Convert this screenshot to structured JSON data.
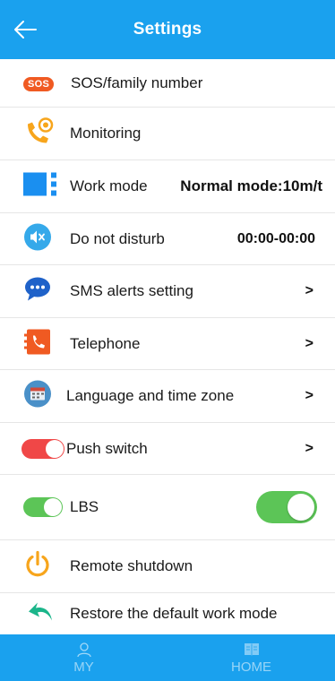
{
  "header": {
    "title": "Settings"
  },
  "rows": [
    {
      "label": "SOS/family number",
      "badge": "SOS"
    },
    {
      "label": "Monitoring"
    },
    {
      "label": "Work mode",
      "value": "Normal mode:10m/t"
    },
    {
      "label": "Do not disturb",
      "value": "00:00-00:00"
    },
    {
      "label": "SMS alerts setting",
      "arrow": ">"
    },
    {
      "label": "Telephone",
      "arrow": ">"
    },
    {
      "label": "Language and time zone",
      "arrow": ">"
    },
    {
      "label": "Push switch",
      "arrow": ">"
    },
    {
      "label": "LBS",
      "toggle_on": true
    },
    {
      "label": "Remote shutdown"
    },
    {
      "label": "Restore the default work mode"
    }
  ],
  "tabs": [
    {
      "label": "MY",
      "icon": "person-icon"
    },
    {
      "label": "HOME",
      "icon": "book-icon"
    }
  ],
  "colors": {
    "accent": "#1aa1ee",
    "sos": "#f05a22",
    "toggle_on": "#5cc557",
    "toggle_red": "#f04747",
    "power": "#f7a51c",
    "restore": "#1bb58a"
  }
}
